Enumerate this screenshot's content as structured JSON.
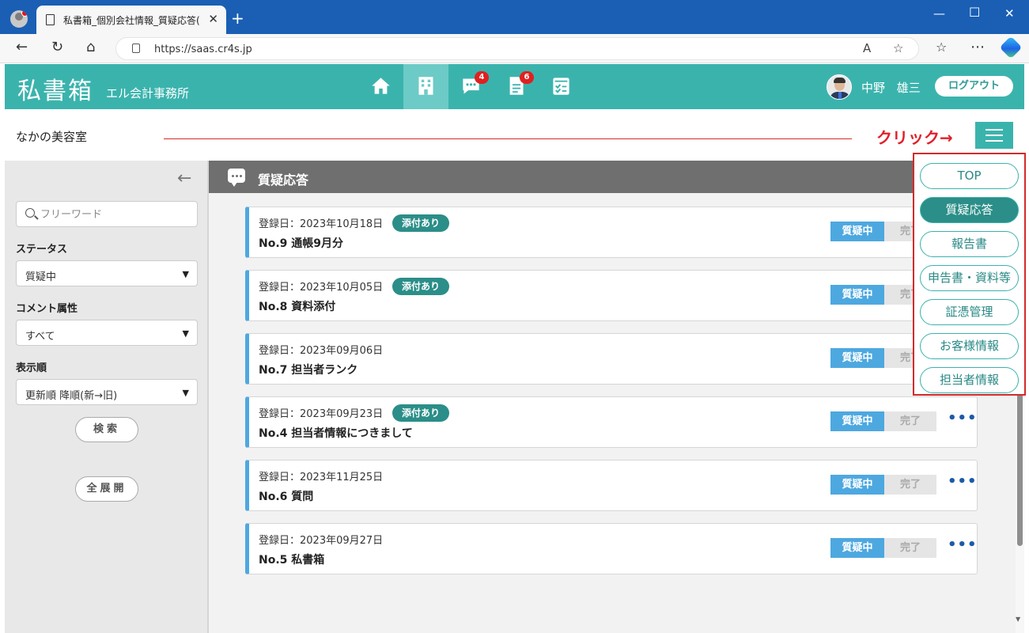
{
  "browser": {
    "tab_title": "私書箱_個別会社情報_質疑応答(",
    "url": "https://saas.cr4s.jp"
  },
  "header": {
    "logo": "私書箱",
    "company": "エル会計事務所",
    "user_name": "中野 雄三",
    "logout_label": "ログアウト",
    "nav": [
      {
        "name": "home-icon",
        "badge": ""
      },
      {
        "name": "building-icon",
        "badge": ""
      },
      {
        "name": "chat-icon",
        "badge": "4"
      },
      {
        "name": "document-icon",
        "badge": "6"
      },
      {
        "name": "checklist-icon",
        "badge": ""
      }
    ]
  },
  "subheader": {
    "client_name": "なかの美容室",
    "click_note": "クリック→"
  },
  "sidebar": {
    "search_placeholder": "フリーワード",
    "status_label": "ステータス",
    "status_value": "質疑中",
    "attr_label": "コメント属性",
    "attr_value": "すべて",
    "order_label": "表示順",
    "order_value": "更新順 降順(新→旧)",
    "search_button": "検索",
    "expand_button": "全展開"
  },
  "main": {
    "title": "質疑応答",
    "status_on_label": "質疑中",
    "status_off_label": "完了",
    "questions": [
      {
        "date": "登録日：2023年10月18日",
        "attachment": "添付あり",
        "title": "No.9 通帳9月分"
      },
      {
        "date": "登録日：2023年10月05日",
        "attachment": "添付あり",
        "title": "No.8 資料添付"
      },
      {
        "date": "登録日：2023年09月06日",
        "attachment": "",
        "title": "No.7 担当者ランク"
      },
      {
        "date": "登録日：2023年09月23日",
        "attachment": "添付あり",
        "title": "No.4 担当者情報につきまして"
      },
      {
        "date": "登録日：2023年11月25日",
        "attachment": "",
        "title": "No.6 質問"
      },
      {
        "date": "登録日：2023年09月27日",
        "attachment": "",
        "title": "No.5 私書箱"
      }
    ]
  },
  "menu": {
    "items": [
      "TOP",
      "質疑応答",
      "報告書",
      "申告書・資料等",
      "証憑管理",
      "お客様情報",
      "担当者情報"
    ],
    "active": "質疑応答"
  },
  "colors": {
    "teal": "#3bb3ad",
    "teal_dark": "#2b8e88",
    "blue": "#4da8e0",
    "red": "#e0202a"
  }
}
